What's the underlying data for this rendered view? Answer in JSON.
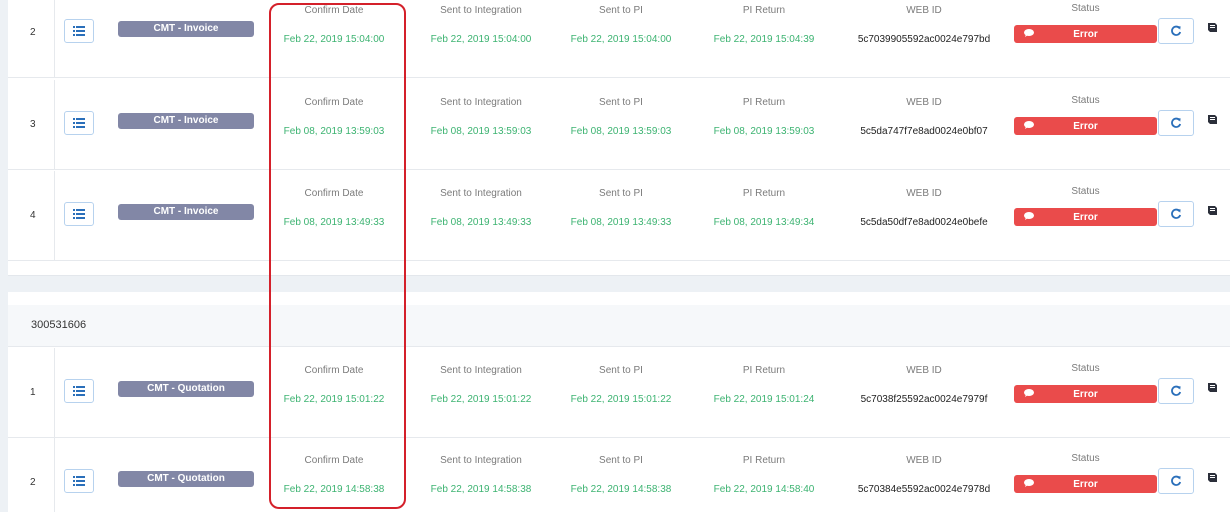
{
  "labels": {
    "confirm_date": "Confirm Date",
    "sent_to_integration": "Sent to Integration",
    "sent_to_pi": "Sent to PI",
    "pi_return": "PI Return",
    "web_id": "WEB ID",
    "status": "Status"
  },
  "icons": {
    "list": "list-icon",
    "refresh": "refresh-icon",
    "book": "book-icon",
    "comment": "comment-bubble-icon"
  },
  "colors": {
    "type_badge": "#8287a6",
    "date_text": "#3cb371",
    "error_badge": "#ea4b4b",
    "highlight_box": "#d4202a"
  },
  "group2_header": "300531606",
  "group1_rows": [
    {
      "index": "2",
      "type": "CMT - Invoice",
      "confirm_date": "Feb 22, 2019 15:04:00",
      "sent_to_integration": "Feb 22, 2019 15:04:00",
      "sent_to_pi": "Feb 22, 2019 15:04:00",
      "pi_return": "Feb 22, 2019 15:04:39",
      "web_id": "5c7039905592ac0024e797bd",
      "status": "Error"
    },
    {
      "index": "3",
      "type": "CMT - Invoice",
      "confirm_date": "Feb 08, 2019 13:59:03",
      "sent_to_integration": "Feb 08, 2019 13:59:03",
      "sent_to_pi": "Feb 08, 2019 13:59:03",
      "pi_return": "Feb 08, 2019 13:59:03",
      "web_id": "5c5da747f7e8ad0024e0bf07",
      "status": "Error"
    },
    {
      "index": "4",
      "type": "CMT - Invoice",
      "confirm_date": "Feb 08, 2019 13:49:33",
      "sent_to_integration": "Feb 08, 2019 13:49:33",
      "sent_to_pi": "Feb 08, 2019 13:49:33",
      "pi_return": "Feb 08, 2019 13:49:34",
      "web_id": "5c5da50df7e8ad0024e0befe",
      "status": "Error"
    }
  ],
  "group2_rows": [
    {
      "index": "1",
      "type": "CMT - Quotation",
      "confirm_date": "Feb 22, 2019 15:01:22",
      "sent_to_integration": "Feb 22, 2019 15:01:22",
      "sent_to_pi": "Feb 22, 2019 15:01:22",
      "pi_return": "Feb 22, 2019 15:01:24",
      "web_id": "5c7038f25592ac0024e7979f",
      "status": "Error"
    },
    {
      "index": "2",
      "type": "CMT - Quotation",
      "confirm_date": "Feb 22, 2019 14:58:38",
      "sent_to_integration": "Feb 22, 2019 14:58:38",
      "sent_to_pi": "Feb 22, 2019 14:58:38",
      "pi_return": "Feb 22, 2019 14:58:40",
      "web_id": "5c70384e5592ac0024e7978d",
      "status": "Error"
    }
  ]
}
